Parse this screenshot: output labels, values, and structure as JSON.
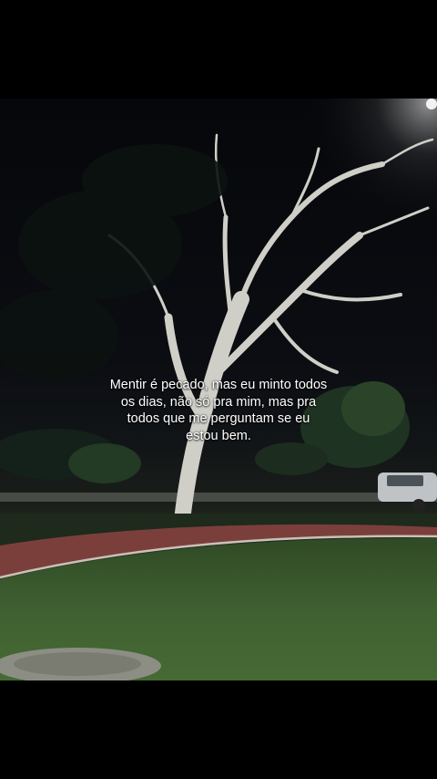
{
  "caption": {
    "text": "Mentir é pecado, mas eu minto todos os dias, não só pra mim, mas pra todos que me perguntam se eu estou bem."
  },
  "scene": {
    "description_icon": "night-park-photo",
    "colors": {
      "sky": "#06070a",
      "grass": "#3a5a2c",
      "path": "#7a3e3a",
      "tree_trunk": "#d8d8d2",
      "caption_text": "#ffffff"
    }
  }
}
